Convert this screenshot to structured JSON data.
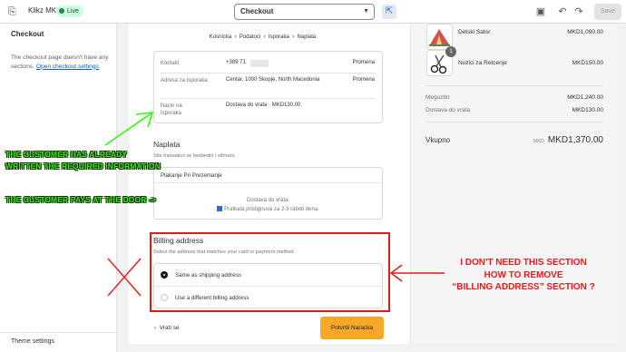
{
  "topbar": {
    "store_name": "Klikz MK",
    "live_badge": "Live",
    "page_select": "Checkout",
    "save_label": "Save"
  },
  "sidebar": {
    "title": "Checkout",
    "message": "The checkout page doesn't have any sections.",
    "link": "Open checkout settings",
    "theme_settings": "Theme settings"
  },
  "checkout": {
    "breadcrumb": [
      "Kosnicka",
      "Podatoci",
      "Isporaka",
      "Naplata"
    ],
    "review": [
      {
        "label": "Kontakt",
        "value": "+389 71",
        "change": "Promena"
      },
      {
        "label": "Adresa za Isporaka",
        "value": "Centar, 1000 Skopje, North Macedonia",
        "change": "Promena"
      },
      {
        "label": "Nacin na Isporaka",
        "value": "Dostava do vrata · MKD130.00",
        "change": ""
      }
    ],
    "payment_title": "Naplata",
    "payment_subtitle": "Site transakcii se bezbedni i sifrirani.",
    "payment_method": "Plakanje Pri Prezemanje",
    "payment_desc_1": "Dostava do vrata.",
    "payment_desc_2": "Pratkata pristignuva za 2-3 raboti dena.",
    "billing_title": "Billing address",
    "billing_subtitle": "Select the address that matches your card or payment method.",
    "billing_options": [
      "Same as shipping address",
      "Use a different billing address"
    ],
    "back_label": "Vrati se",
    "confirm_label": "Potvrdi Naracka"
  },
  "summary": {
    "items": [
      {
        "name": "Detski Sator",
        "price": "MKD1,090.00",
        "qty": ""
      },
      {
        "name": "Nozici za Retcenje",
        "price": "MKD150.00",
        "qty": "1"
      }
    ],
    "subtotal_label": "Meguzbir",
    "subtotal": "MKD1,240.00",
    "shipping_label": "Dostava do vrata",
    "shipping": "MKD130.00",
    "total_label": "Vkupno",
    "total_currency": "MKD",
    "total": "MKD1,370.00"
  },
  "annotations": {
    "green_1": "THE CUSTOMER HAS ALREADY",
    "green_2": "WRITTEN THE REQUIRED INFORMATION",
    "green_3": "THE CUSTOMER PAYS AT THE DOOR ->",
    "red_1": "I DON'T NEED THIS SECTION",
    "red_2": "HOW TO REMOVE",
    "red_3": "“BILLING ADDRESS” SECTION ?"
  },
  "colors": {
    "confirm_button": "#f7a826",
    "annotation_green": "#37f000",
    "annotation_red": "#ec1a1a"
  }
}
